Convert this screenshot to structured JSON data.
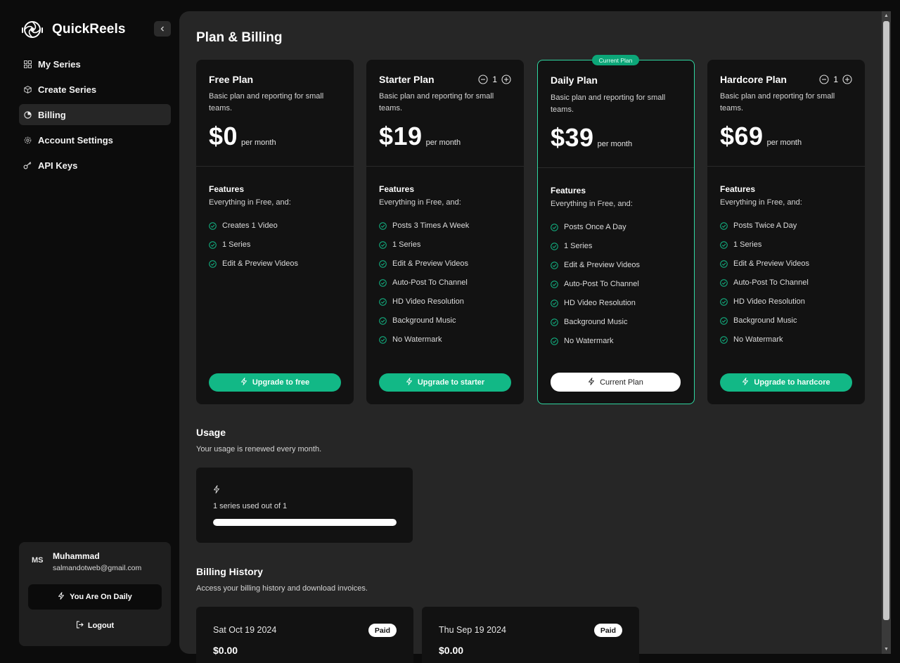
{
  "app": {
    "name": "QuickReels"
  },
  "sidebar": {
    "items": [
      {
        "label": "My Series",
        "icon": "grid-icon"
      },
      {
        "label": "Create Series",
        "icon": "box-icon"
      },
      {
        "label": "Billing",
        "icon": "pie-chart-icon",
        "active": true
      },
      {
        "label": "Account Settings",
        "icon": "gear-icon"
      },
      {
        "label": "API Keys",
        "icon": "key-icon"
      }
    ],
    "user": {
      "initials": "MS",
      "name": "Muhammad",
      "email": "salmandotweb@gmail.com",
      "plan_button": "You Are On Daily",
      "logout": "Logout"
    }
  },
  "page": {
    "title": "Plan & Billing"
  },
  "plans": [
    {
      "title": "Free Plan",
      "desc": "Basic plan and reporting for small teams.",
      "price": "$0",
      "per": "per month",
      "features_title": "Features",
      "features_sub": "Everything in Free, and:",
      "features": [
        "Creates 1 Video",
        "1 Series",
        "Edit & Preview Videos"
      ],
      "button": "Upgrade to free"
    },
    {
      "title": "Starter Plan",
      "desc": "Basic plan and reporting for small teams.",
      "price": "$19",
      "per": "per month",
      "quantity": "1",
      "features_title": "Features",
      "features_sub": "Everything in Free, and:",
      "features": [
        "Posts 3 Times A Week",
        "1 Series",
        "Edit & Preview Videos",
        "Auto-Post To Channel",
        "HD Video Resolution",
        "Background Music",
        "No Watermark"
      ],
      "button": "Upgrade to starter"
    },
    {
      "title": "Daily Plan",
      "badge": "Current Plan",
      "desc": "Basic plan and reporting for small teams.",
      "price": "$39",
      "per": "per month",
      "features_title": "Features",
      "features_sub": "Everything in Free, and:",
      "features": [
        "Posts Once A Day",
        "1 Series",
        "Edit & Preview Videos",
        "Auto-Post To Channel",
        "HD Video Resolution",
        "Background Music",
        "No Watermark"
      ],
      "button": "Current Plan"
    },
    {
      "title": "Hardcore Plan",
      "desc": "Basic plan and reporting for small teams.",
      "price": "$69",
      "per": "per month",
      "quantity": "1",
      "features_title": "Features",
      "features_sub": "Everything in Free, and:",
      "features": [
        "Posts Twice A Day",
        "1 Series",
        "Edit & Preview Videos",
        "Auto-Post To Channel",
        "HD Video Resolution",
        "Background Music",
        "No Watermark"
      ],
      "button": "Upgrade to hardcore"
    }
  ],
  "usage": {
    "title": "Usage",
    "subtitle": "Your usage is renewed every month.",
    "text": "1 series used out of 1",
    "progress": 1.0
  },
  "billing_history": {
    "title": "Billing History",
    "subtitle": "Access your billing history and download invoices.",
    "invoices": [
      {
        "date": "Sat Oct 19 2024",
        "status": "Paid",
        "amount": "$0.00"
      },
      {
        "date": "Thu Sep 19 2024",
        "status": "Paid",
        "amount": "$0.00"
      }
    ]
  },
  "colors": {
    "accent": "#12b886",
    "current_border": "#2fd6a0",
    "card_bg": "#121212",
    "panel_bg": "#262626"
  }
}
